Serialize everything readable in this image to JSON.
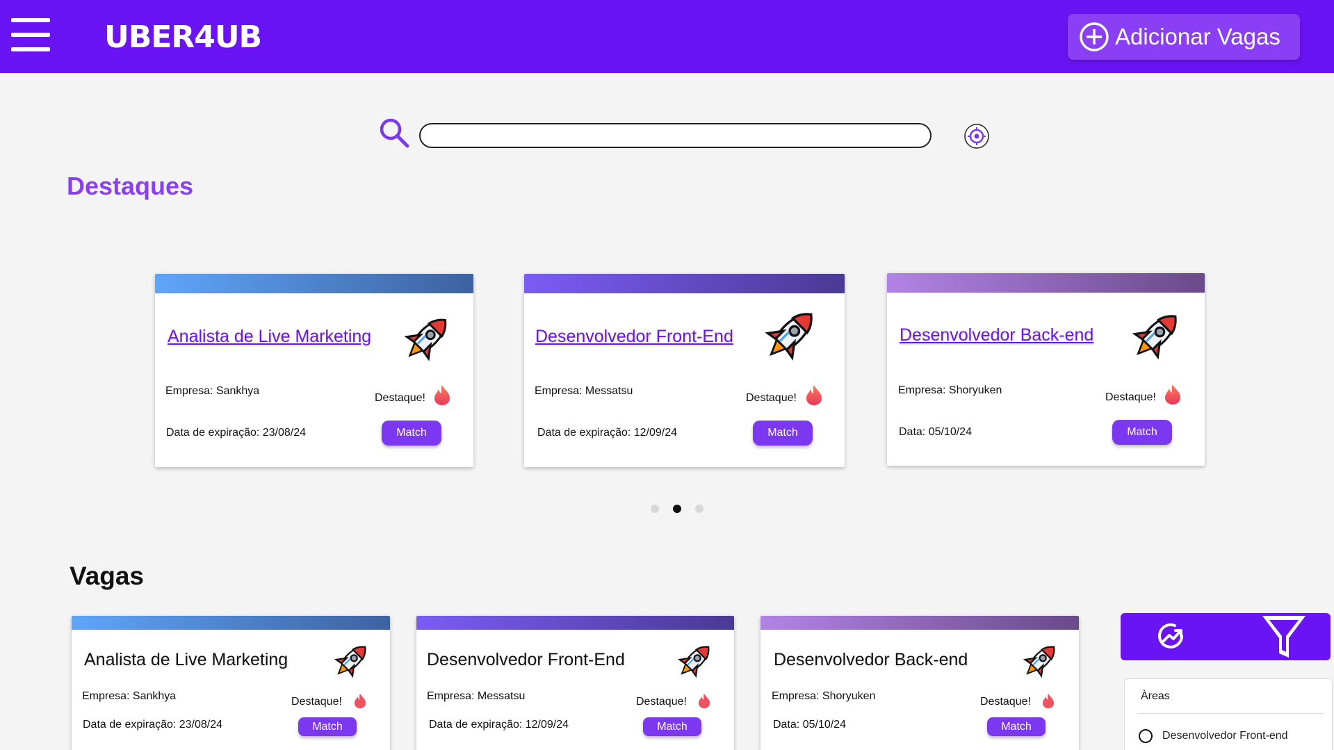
{
  "header": {
    "logo": "UBER4UB",
    "add_button_label": "Adicionar Vagas"
  },
  "search": {
    "value": ""
  },
  "destaques": {
    "title": "Destaques",
    "cards": [
      {
        "title": "Analista de Live Marketing",
        "company": "Empresa: Sankhya",
        "badge": "Destaque!",
        "date": "Data de expiração:  23/08/24",
        "match_label": "Match"
      },
      {
        "title": "Desenvolvedor Front-End",
        "company": "Empresa: Messatsu",
        "badge": "Destaque!",
        "date": "Data de expiração: 12/09/24",
        "match_label": "Match"
      },
      {
        "title": "Desenvolvedor Back-end",
        "company": "Empresa: Shoryuken",
        "badge": "Destaque!",
        "date": "Data:  05/10/24",
        "match_label": "Match"
      }
    ]
  },
  "vagas": {
    "title": "Vagas",
    "cards": [
      {
        "title": "Analista de Live Marketing",
        "company": "Empresa: Sankhya",
        "badge": "Destaque!",
        "date": "Data de expiração:  23/08/24",
        "match_label": "Match"
      },
      {
        "title": "Desenvolvedor Front-End",
        "company": "Empresa: Messatsu",
        "badge": "Destaque!",
        "date": "Data de expiração: 12/09/24",
        "match_label": "Match"
      },
      {
        "title": "Desenvolvedor Back-end",
        "company": "Empresa: Shoryuken",
        "badge": "Destaque!",
        "date": "Data:  05/10/24",
        "match_label": "Match"
      }
    ]
  },
  "filters": {
    "areas_label": "Àreas",
    "options": [
      "Desenvolvedor Front-end"
    ]
  },
  "carousel": {
    "active_index": 1,
    "count": 3
  },
  "colors": {
    "brand": "#6a13f3",
    "accent": "#8b3ff5",
    "button": "#7c37f0"
  }
}
